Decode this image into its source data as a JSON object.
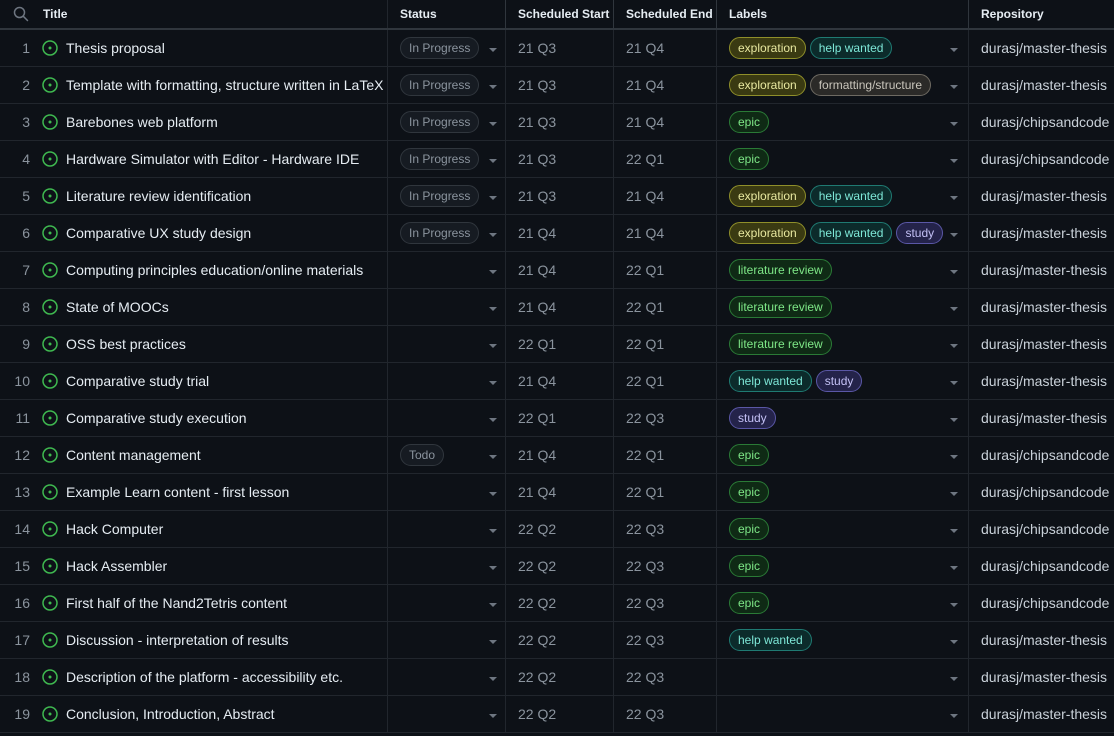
{
  "header": {
    "title": "Title",
    "status": "Status",
    "scheduled_start": "Scheduled Start",
    "scheduled_end": "Scheduled End",
    "labels": "Labels",
    "repository": "Repository"
  },
  "label_colors": {
    "exploration": {
      "bg": "#3a3a12",
      "border": "#8f8f2a",
      "fg": "#e8e8a0"
    },
    "help wanted": {
      "bg": "#0c2b2b",
      "border": "#1f7a72",
      "fg": "#7ee8d8"
    },
    "formatting/structure": {
      "bg": "#2b2a28",
      "border": "#6e6a62",
      "fg": "#c9c5bb"
    },
    "epic": {
      "bg": "#0f2a15",
      "border": "#2a7a36",
      "fg": "#7ee787"
    },
    "literature review": {
      "bg": "#0f2a15",
      "border": "#2a7a36",
      "fg": "#7ee787"
    },
    "study": {
      "bg": "#24234a",
      "border": "#5a57a6",
      "fg": "#c3c0f5"
    }
  },
  "rows": [
    {
      "num": "1",
      "title": "Thesis proposal",
      "status": "In Progress",
      "start": "21 Q3",
      "end": "21 Q4",
      "labels": [
        "exploration",
        "help wanted"
      ],
      "repo": "durasj/master-thesis"
    },
    {
      "num": "2",
      "title": "Template with formatting, structure written in LaTeX",
      "status": "In Progress",
      "start": "21 Q3",
      "end": "21 Q4",
      "labels": [
        "exploration",
        "formatting/structure"
      ],
      "repo": "durasj/master-thesis"
    },
    {
      "num": "3",
      "title": "Barebones web platform",
      "status": "In Progress",
      "start": "21 Q3",
      "end": "21 Q4",
      "labels": [
        "epic"
      ],
      "repo": "durasj/chipsandcode"
    },
    {
      "num": "4",
      "title": "Hardware Simulator with Editor - Hardware IDE",
      "status": "In Progress",
      "start": "21 Q3",
      "end": "22 Q1",
      "labels": [
        "epic"
      ],
      "repo": "durasj/chipsandcode"
    },
    {
      "num": "5",
      "title": "Literature review identification",
      "status": "In Progress",
      "start": "21 Q3",
      "end": "21 Q4",
      "labels": [
        "exploration",
        "help wanted"
      ],
      "repo": "durasj/master-thesis"
    },
    {
      "num": "6",
      "title": "Comparative UX study design",
      "status": "In Progress",
      "start": "21 Q4",
      "end": "21 Q4",
      "labels": [
        "exploration",
        "help wanted",
        "study"
      ],
      "repo": "durasj/master-thesis"
    },
    {
      "num": "7",
      "title": "Computing principles education/online materials",
      "status": "",
      "start": "21 Q4",
      "end": "22 Q1",
      "labels": [
        "literature review"
      ],
      "repo": "durasj/master-thesis"
    },
    {
      "num": "8",
      "title": "State of MOOCs",
      "status": "",
      "start": "21 Q4",
      "end": "22 Q1",
      "labels": [
        "literature review"
      ],
      "repo": "durasj/master-thesis"
    },
    {
      "num": "9",
      "title": "OSS best practices",
      "status": "",
      "start": "22 Q1",
      "end": "22 Q1",
      "labels": [
        "literature review"
      ],
      "repo": "durasj/master-thesis"
    },
    {
      "num": "10",
      "title": "Comparative study trial",
      "status": "",
      "start": "21 Q4",
      "end": "22 Q1",
      "labels": [
        "help wanted",
        "study"
      ],
      "repo": "durasj/master-thesis"
    },
    {
      "num": "11",
      "title": "Comparative study execution",
      "status": "",
      "start": "22 Q1",
      "end": "22 Q3",
      "labels": [
        "study"
      ],
      "repo": "durasj/master-thesis"
    },
    {
      "num": "12",
      "title": "Content management",
      "status": "Todo",
      "start": "21 Q4",
      "end": "22 Q1",
      "labels": [
        "epic"
      ],
      "repo": "durasj/chipsandcode"
    },
    {
      "num": "13",
      "title": "Example Learn content - first lesson",
      "status": "",
      "start": "21 Q4",
      "end": "22 Q1",
      "labels": [
        "epic"
      ],
      "repo": "durasj/chipsandcode"
    },
    {
      "num": "14",
      "title": "Hack Computer",
      "status": "",
      "start": "22 Q2",
      "end": "22 Q3",
      "labels": [
        "epic"
      ],
      "repo": "durasj/chipsandcode"
    },
    {
      "num": "15",
      "title": "Hack Assembler",
      "status": "",
      "start": "22 Q2",
      "end": "22 Q3",
      "labels": [
        "epic"
      ],
      "repo": "durasj/chipsandcode"
    },
    {
      "num": "16",
      "title": "First half of the Nand2Tetris content",
      "status": "",
      "start": "22 Q2",
      "end": "22 Q3",
      "labels": [
        "epic"
      ],
      "repo": "durasj/chipsandcode"
    },
    {
      "num": "17",
      "title": "Discussion - interpretation of results",
      "status": "",
      "start": "22 Q2",
      "end": "22 Q3",
      "labels": [
        "help wanted"
      ],
      "repo": "durasj/master-thesis"
    },
    {
      "num": "18",
      "title": "Description of the platform - accessibility etc.",
      "status": "",
      "start": "22 Q2",
      "end": "22 Q3",
      "labels": [],
      "repo": "durasj/master-thesis"
    },
    {
      "num": "19",
      "title": "Conclusion, Introduction, Abstract",
      "status": "",
      "start": "22 Q2",
      "end": "22 Q3",
      "labels": [],
      "repo": "durasj/master-thesis"
    }
  ]
}
